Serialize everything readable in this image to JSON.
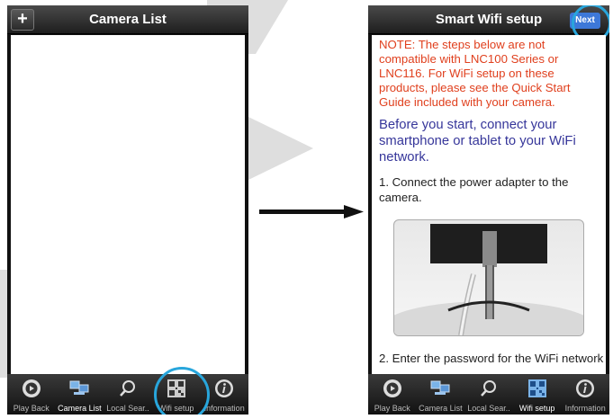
{
  "left_screen": {
    "title": "Camera List",
    "add_button": "+"
  },
  "right_screen": {
    "title": "Smart Wifi setup",
    "next_button": "Next",
    "note": "NOTE: The steps below are not compatible with LNC100 Series or LNC116. For WiFi setup on these products, please see the Quick Start Guide included with your camera.",
    "before": "Before you start, connect your smartphone or tablet to your WiFi network.",
    "step1": "1. Connect the power adapter to the camera.",
    "step2": "2. Enter the password for the WiFi network"
  },
  "left_tabs": [
    {
      "label": "Play Back",
      "icon": "playback-icon"
    },
    {
      "label": "Camera List",
      "icon": "camera-list-icon"
    },
    {
      "label": "Local Sear..",
      "icon": "search-icon"
    },
    {
      "label": "Wifi setup",
      "icon": "qr-code-icon"
    },
    {
      "label": "Information",
      "icon": "info-icon"
    }
  ],
  "right_tabs": [
    {
      "label": "Play Back",
      "icon": "playback-icon"
    },
    {
      "label": "Camera List",
      "icon": "camera-list-icon"
    },
    {
      "label": "Local Sear..",
      "icon": "search-icon"
    },
    {
      "label": "Wifi setup",
      "icon": "qr-code-icon"
    },
    {
      "label": "Information",
      "icon": "info-icon"
    }
  ],
  "colors": {
    "highlight_circle": "#28a6dc",
    "note_text": "#e0401e",
    "before_text": "#36369a",
    "next_button": "#3d78d8"
  }
}
